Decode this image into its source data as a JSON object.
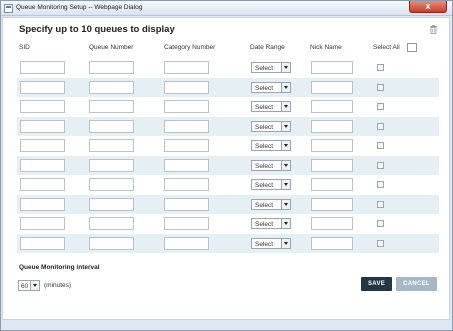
{
  "window": {
    "title": "Queue Monitoring Setup -- Webpage Dialog",
    "close_glyph": "x"
  },
  "dialog": {
    "heading": "Specify up to 10 queues to display",
    "columns": {
      "sid": "SID",
      "queue_number": "Queue Number",
      "category_number": "Category Number",
      "date_range": "Date Range",
      "nick_name": "Nick Name",
      "select_all": "Select All"
    },
    "rows": [
      {
        "sid": "",
        "queue_number": "",
        "category_number": "",
        "date_range": "Select",
        "nick_name": "",
        "selected": false
      },
      {
        "sid": "",
        "queue_number": "",
        "category_number": "",
        "date_range": "Select",
        "nick_name": "",
        "selected": false
      },
      {
        "sid": "",
        "queue_number": "",
        "category_number": "",
        "date_range": "Select",
        "nick_name": "",
        "selected": false
      },
      {
        "sid": "",
        "queue_number": "",
        "category_number": "",
        "date_range": "Select",
        "nick_name": "",
        "selected": false
      },
      {
        "sid": "",
        "queue_number": "",
        "category_number": "",
        "date_range": "Select",
        "nick_name": "",
        "selected": false
      },
      {
        "sid": "",
        "queue_number": "",
        "category_number": "",
        "date_range": "Select",
        "nick_name": "",
        "selected": false
      },
      {
        "sid": "",
        "queue_number": "",
        "category_number": "",
        "date_range": "Select",
        "nick_name": "",
        "selected": false
      },
      {
        "sid": "",
        "queue_number": "",
        "category_number": "",
        "date_range": "Select",
        "nick_name": "",
        "selected": false
      },
      {
        "sid": "",
        "queue_number": "",
        "category_number": "",
        "date_range": "Select",
        "nick_name": "",
        "selected": false
      },
      {
        "sid": "",
        "queue_number": "",
        "category_number": "",
        "date_range": "Select",
        "nick_name": "",
        "selected": false
      }
    ],
    "interval": {
      "label": "Queue Monitoring interval",
      "value": "60",
      "unit": "(minutes)"
    },
    "buttons": {
      "save": "SAVE",
      "cancel": "CANCEL"
    }
  },
  "icons": {
    "trash": "trash-icon",
    "dropdown": "chevron-down-icon",
    "window": "window-icon"
  },
  "colors": {
    "save_bg": "#253746",
    "cancel_bg": "#a7b8c5",
    "row_alt": "#e6f0f4",
    "close_bg": "#c2412a"
  }
}
